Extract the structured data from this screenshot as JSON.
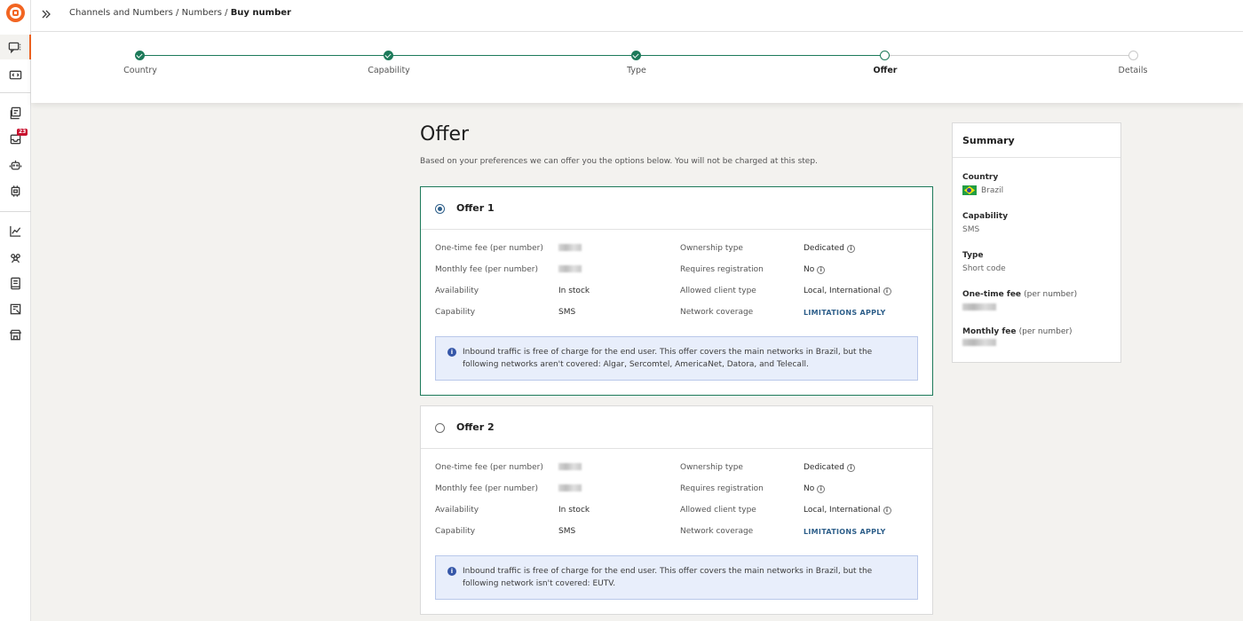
{
  "breadcrumb": {
    "items": [
      "Channels and Numbers",
      "Numbers"
    ],
    "separator": " / ",
    "current": "Buy number"
  },
  "rail": {
    "badge_count": "23"
  },
  "stepper": {
    "steps": [
      {
        "label": "Country",
        "state": "done"
      },
      {
        "label": "Capability",
        "state": "done"
      },
      {
        "label": "Type",
        "state": "done"
      },
      {
        "label": "Offer",
        "state": "current"
      },
      {
        "label": "Details",
        "state": "todo"
      }
    ]
  },
  "page": {
    "title": "Offer",
    "subtitle": "Based on your preferences we can offer you the options below. You will not be charged at this step."
  },
  "offers": [
    {
      "title": "Offer 1",
      "selected": true,
      "one_time_fee_label": "One-time fee (per number)",
      "monthly_fee_label": "Monthly fee (per number)",
      "availability_label": "Availability",
      "availability": "In stock",
      "capability_label": "Capability",
      "capability": "SMS",
      "ownership_label": "Ownership type",
      "ownership": "Dedicated",
      "registration_label": "Requires registration",
      "registration": "No",
      "client_type_label": "Allowed client type",
      "client_type": "Local, International",
      "coverage_label": "Network coverage",
      "coverage": "LIMITATIONS APPLY",
      "notice": "Inbound traffic is free of charge for the end user. This offer covers the main networks in Brazil, but the following networks aren't covered: Algar, Sercomtel, AmericaNet, Datora, and Telecall."
    },
    {
      "title": "Offer 2",
      "selected": false,
      "one_time_fee_label": "One-time fee (per number)",
      "monthly_fee_label": "Monthly fee (per number)",
      "availability_label": "Availability",
      "availability": "In stock",
      "capability_label": "Capability",
      "capability": "SMS",
      "ownership_label": "Ownership type",
      "ownership": "Dedicated",
      "registration_label": "Requires registration",
      "registration": "No",
      "client_type_label": "Allowed client type",
      "client_type": "Local, International",
      "coverage_label": "Network coverage",
      "coverage": "LIMITATIONS APPLY",
      "notice": "Inbound traffic is free of charge for the end user. This offer covers the main networks in Brazil, but the following network isn't covered: EUTV."
    }
  ],
  "summary": {
    "title": "Summary",
    "country_label": "Country",
    "country": "Brazil",
    "capability_label": "Capability",
    "capability": "SMS",
    "type_label": "Type",
    "type": "Short code",
    "one_time_fee_label": "One-time fee",
    "one_time_fee_suffix": "(per number)",
    "monthly_fee_label": "Monthly fee",
    "monthly_fee_suffix": "(per number)"
  },
  "colors": {
    "brand": "#f26522",
    "step_done": "#1d7a5a",
    "selected_border": "#1d7a5a",
    "link": "#2e5f8a",
    "notice_bg": "#e8eefb",
    "badge": "#c8102e"
  }
}
